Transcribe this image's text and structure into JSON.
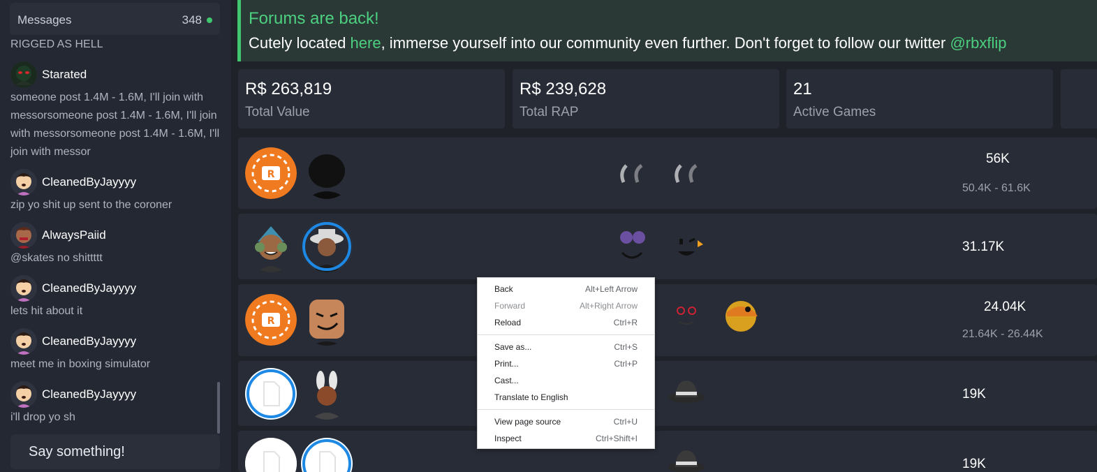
{
  "sidebar": {
    "header": {
      "title": "Messages",
      "count": "348"
    },
    "fragment": "RIGGED AS HELL",
    "messages": [
      {
        "user": "Starated",
        "text": "someone post 1.4M - 1.6M, I'll join with messorsomeone post 1.4M - 1.6M, I'll join with messorsomeone post 1.4M - 1.6M, I'll join with messor"
      },
      {
        "user": "CleanedByJayyyy",
        "text": "zip yo shit up sent to the coroner"
      },
      {
        "user": "AlwaysPaiid",
        "text": "@skates no shittttt"
      },
      {
        "user": "CleanedByJayyyy",
        "text": "lets hit about it"
      },
      {
        "user": "CleanedByJayyyy",
        "text": "meet me in boxing simulator"
      },
      {
        "user": "CleanedByJayyyy",
        "text": "i'll drop yo sh"
      }
    ],
    "input_placeholder": "Say something!"
  },
  "banner": {
    "title": "Forums are back!",
    "pre": "Cutely located ",
    "link": "here",
    "mid": ", immerse yourself into our community even further. Don't forget to follow our twitter ",
    "handle": "@rbxflip"
  },
  "stats": [
    {
      "value": "R$ 263,819",
      "label": "Total Value"
    },
    {
      "value": "R$ 239,628",
      "label": "Total RAP"
    },
    {
      "value": "21",
      "label": "Active Games"
    }
  ],
  "games": [
    {
      "value": "56K",
      "range": "50.4K - 61.6K"
    },
    {
      "value": "31.17K",
      "range": ""
    },
    {
      "value": "24.04K",
      "range": "21.64K - 26.44K"
    },
    {
      "value": "19K",
      "range": ""
    },
    {
      "value": "19K",
      "range": ""
    }
  ],
  "context_menu": {
    "items": [
      {
        "label": "Back",
        "shortcut": "Alt+Left Arrow"
      },
      {
        "label": "Forward",
        "shortcut": "Alt+Right Arrow"
      },
      {
        "label": "Reload",
        "shortcut": "Ctrl+R"
      },
      {
        "label": "Save as...",
        "shortcut": "Ctrl+S"
      },
      {
        "label": "Print...",
        "shortcut": "Ctrl+P"
      },
      {
        "label": "Cast...",
        "shortcut": ""
      },
      {
        "label": "Translate to English",
        "shortcut": ""
      },
      {
        "label": "View page source",
        "shortcut": "Ctrl+U"
      },
      {
        "label": "Inspect",
        "shortcut": "Ctrl+Shift+I"
      }
    ]
  },
  "colors": {
    "accent": "#3fc66f",
    "ring": "#1e88e5",
    "chip": "#f07a1f"
  },
  "icons": [
    "chip-icon",
    "file-icon",
    "avatar-icon",
    "horns-icon",
    "fedora-icon",
    "face-icon"
  ]
}
